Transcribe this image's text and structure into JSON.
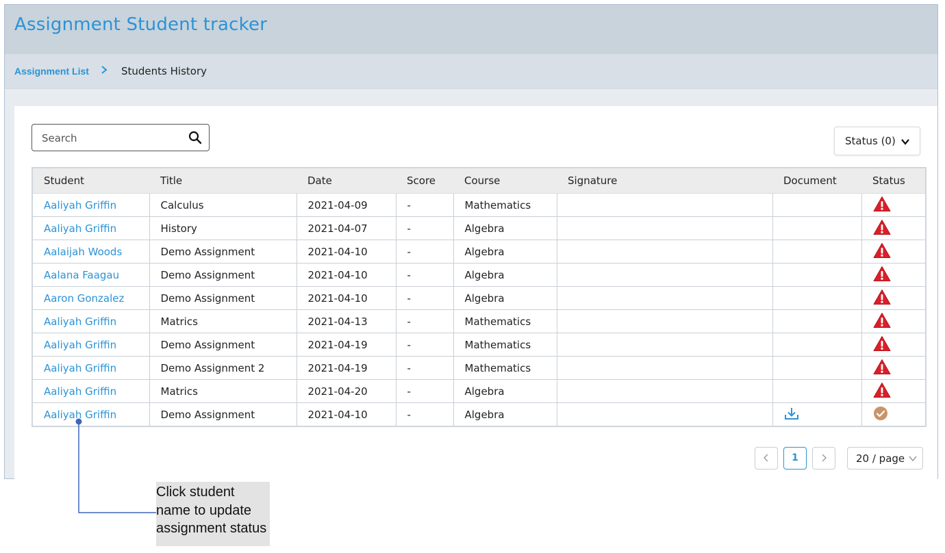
{
  "app": {
    "title": "Assignment Student tracker"
  },
  "breadcrumb": {
    "parent": "Assignment List",
    "current": "Students History"
  },
  "search": {
    "placeholder": "Search",
    "value": ""
  },
  "status_filter": {
    "label": "Status (0)"
  },
  "table": {
    "columns": [
      "Student",
      "Title",
      "Date",
      "Score",
      "Course",
      "Signature",
      "Document",
      "Status"
    ],
    "rows": [
      {
        "student": "Aaliyah Griffin",
        "title": "Calculus",
        "date": "2021-04-09",
        "score": "-",
        "course": "Mathematics",
        "signature": "",
        "document": "",
        "status": "warning"
      },
      {
        "student": "Aaliyah Griffin",
        "title": "History",
        "date": "2021-04-07",
        "score": "-",
        "course": "Algebra",
        "signature": "",
        "document": "",
        "status": "warning"
      },
      {
        "student": "Aalaijah Woods",
        "title": "Demo Assignment",
        "date": "2021-04-10",
        "score": "-",
        "course": "Algebra",
        "signature": "",
        "document": "",
        "status": "warning"
      },
      {
        "student": "Aalana Faagau",
        "title": "Demo Assignment",
        "date": "2021-04-10",
        "score": "-",
        "course": "Algebra",
        "signature": "",
        "document": "",
        "status": "warning"
      },
      {
        "student": "Aaron Gonzalez",
        "title": "Demo Assignment",
        "date": "2021-04-10",
        "score": "-",
        "course": "Algebra",
        "signature": "",
        "document": "",
        "status": "warning"
      },
      {
        "student": "Aaliyah Griffin",
        "title": "Matrics",
        "date": "2021-04-13",
        "score": "-",
        "course": "Mathematics",
        "signature": "",
        "document": "",
        "status": "warning"
      },
      {
        "student": "Aaliyah Griffin",
        "title": "Demo Assignment",
        "date": "2021-04-19",
        "score": "-",
        "course": "Mathematics",
        "signature": "",
        "document": "",
        "status": "warning"
      },
      {
        "student": "Aaliyah Griffin",
        "title": "Demo Assignment 2",
        "date": "2021-04-19",
        "score": "-",
        "course": "Mathematics",
        "signature": "",
        "document": "",
        "status": "warning"
      },
      {
        "student": "Aaliyah Griffin",
        "title": "Matrics",
        "date": "2021-04-20",
        "score": "-",
        "course": "Algebra",
        "signature": "",
        "document": "",
        "status": "warning"
      },
      {
        "student": "Aaliyah Griffin",
        "title": "Demo Assignment",
        "date": "2021-04-10",
        "score": "-",
        "course": "Algebra",
        "signature": "",
        "document": "download",
        "status": "completed"
      }
    ]
  },
  "icons": {
    "search": "search-icon",
    "breadcrumb_separator": "chevron-right-icon",
    "dropdown": "chevron-down-icon",
    "warning": "warning-triangle-icon",
    "completed": "check-circle-icon",
    "download": "download-icon",
    "prev": "chevron-left-icon",
    "next": "chevron-right-icon"
  },
  "colors": {
    "accent": "#2b93d6",
    "warning": "#d9202a",
    "completed": "#c8946a",
    "header_bar": "#c8d3dc"
  },
  "pagination": {
    "prev": "<",
    "current_page": "1",
    "next": ">",
    "page_size": "20 / page"
  },
  "annotation": {
    "text": "Click student name to update assignment status"
  }
}
